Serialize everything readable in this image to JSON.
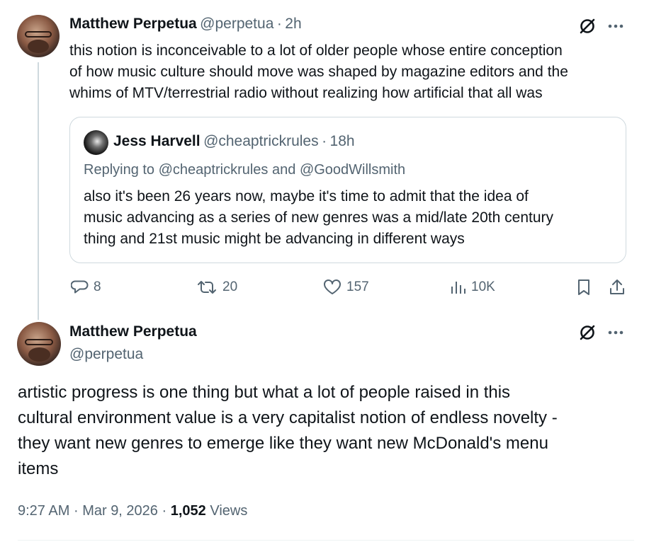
{
  "tweet1": {
    "author_name": "Matthew Perpetua",
    "handle": "@perpetua",
    "separator": "·",
    "time": "2h",
    "text": "this notion is inconceivable to a lot of older people whose entire conception of how music culture should move was shaped by magazine editors and the whims of MTV/terrestrial radio without realizing how artificial that all was",
    "line1": "this notion is inconceivable to a lot of older people whose entire conception",
    "line2": "of how music culture should move was shaped by magazine editors and the",
    "line3": "whims of MTV/terrestrial radio without realizing how artificial that all was",
    "quote": {
      "author_name": "Jess Harvell",
      "handle": "@cheaptrickrules",
      "separator": "·",
      "time": "18h",
      "replying_prefix": "Replying to",
      "replying_user1": "@cheaptrickrules",
      "replying_and": "and",
      "replying_user2": "@GoodWillsmith",
      "line1": "also it's been 26 years now, maybe it's time to admit that the idea of",
      "line2": "music advancing as a series of new genres was a mid/late 20th century",
      "line3": "thing and 21st music might be advancing in different ways"
    },
    "actions": {
      "replies": "8",
      "reposts": "20",
      "likes": "157",
      "views": "10K"
    }
  },
  "tweet2": {
    "author_name": "Matthew Perpetua",
    "handle": "@perpetua",
    "line1": "artistic progress is one thing but what a lot of people raised in this",
    "line2": "cultural environment value is a very capitalist notion of endless novelty -",
    "line3": "they want new genres to emerge like they want new McDonald's menu",
    "line4": "items",
    "meta": {
      "time": "9:27 AM",
      "sep1": "·",
      "date": "Mar 9, 2026",
      "sep2": "·",
      "views_count": "1,052",
      "views_label": "Views"
    }
  },
  "icons": {
    "grok": "grok-icon",
    "more": "more-icon",
    "reply": "reply-icon",
    "repost": "repost-icon",
    "like": "like-icon",
    "views": "views-icon",
    "bookmark": "bookmark-icon",
    "share": "share-icon"
  },
  "colors": {
    "text": "#0f1419",
    "secondary": "#536471",
    "border": "#cfd9de"
  }
}
